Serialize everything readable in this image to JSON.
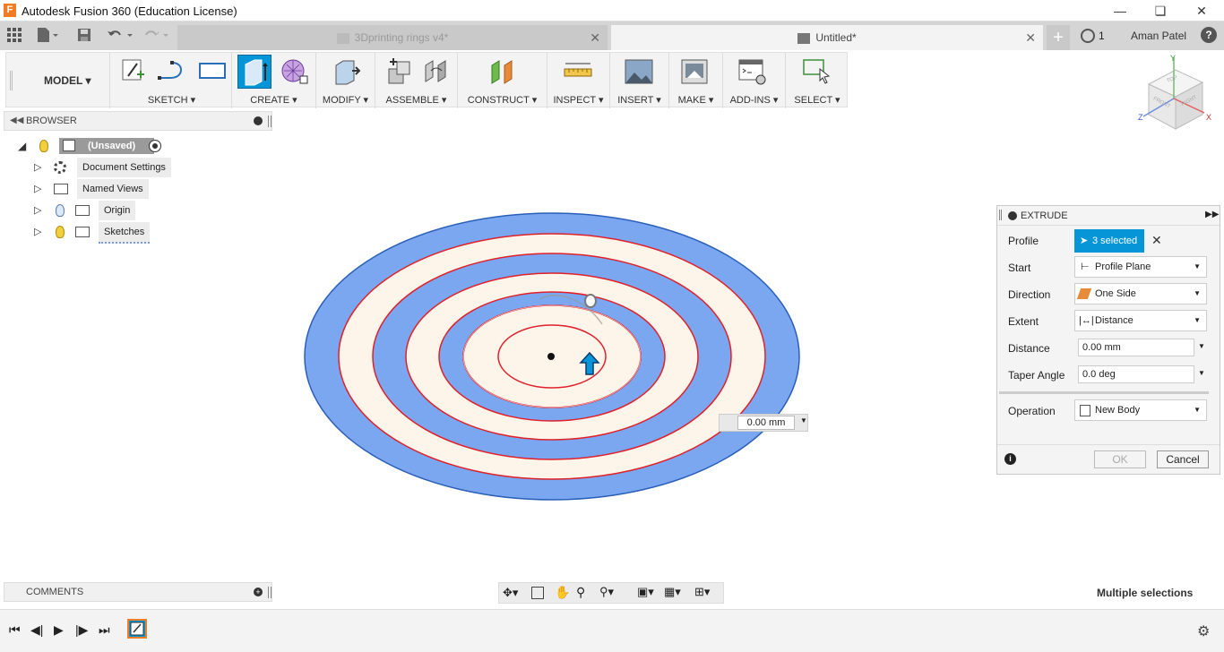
{
  "window": {
    "title": "Autodesk Fusion 360 (Education License)",
    "logo_letter": "F"
  },
  "tabs": [
    {
      "label": "3Dprinting rings v4*",
      "active": false
    },
    {
      "label": "Untitled*",
      "active": true
    }
  ],
  "header": {
    "job_count": "1",
    "user": "Aman Patel",
    "help": "?"
  },
  "toolbar": {
    "workspace": "MODEL",
    "groups": [
      "SKETCH",
      "CREATE",
      "MODIFY",
      "ASSEMBLE",
      "CONSTRUCT",
      "INSPECT",
      "INSERT",
      "MAKE",
      "ADD-INS",
      "SELECT"
    ]
  },
  "browser": {
    "title": "BROWSER",
    "root": "(Unsaved)",
    "items": [
      "Document Settings",
      "Named Views",
      "Origin",
      "Sketches"
    ]
  },
  "viewcube": {
    "top": "TOP",
    "front": "FRONT",
    "right": "RIGHT",
    "axis_x": "X",
    "axis_y": "Y",
    "axis_z": "Z"
  },
  "canvas": {
    "distance_input": "0.00 mm"
  },
  "extrude": {
    "title": "EXTRUDE",
    "profile_label": "Profile",
    "profile_value": "3 selected",
    "start_label": "Start",
    "start_value": "Profile Plane",
    "direction_label": "Direction",
    "direction_value": "One Side",
    "extent_label": "Extent",
    "extent_value": "Distance",
    "distance_label": "Distance",
    "distance_value": "0.00 mm",
    "taper_label": "Taper Angle",
    "taper_value": "0.0 deg",
    "operation_label": "Operation",
    "operation_value": "New Body",
    "ok": "OK",
    "cancel": "Cancel"
  },
  "comments": {
    "title": "COMMENTS"
  },
  "status": {
    "text": "Multiple selections"
  },
  "colors": {
    "accent": "#0696d7",
    "ring_blue": "#7aa7f0",
    "ring_cream": "#fdf5ea",
    "outline": "#e0202a"
  }
}
